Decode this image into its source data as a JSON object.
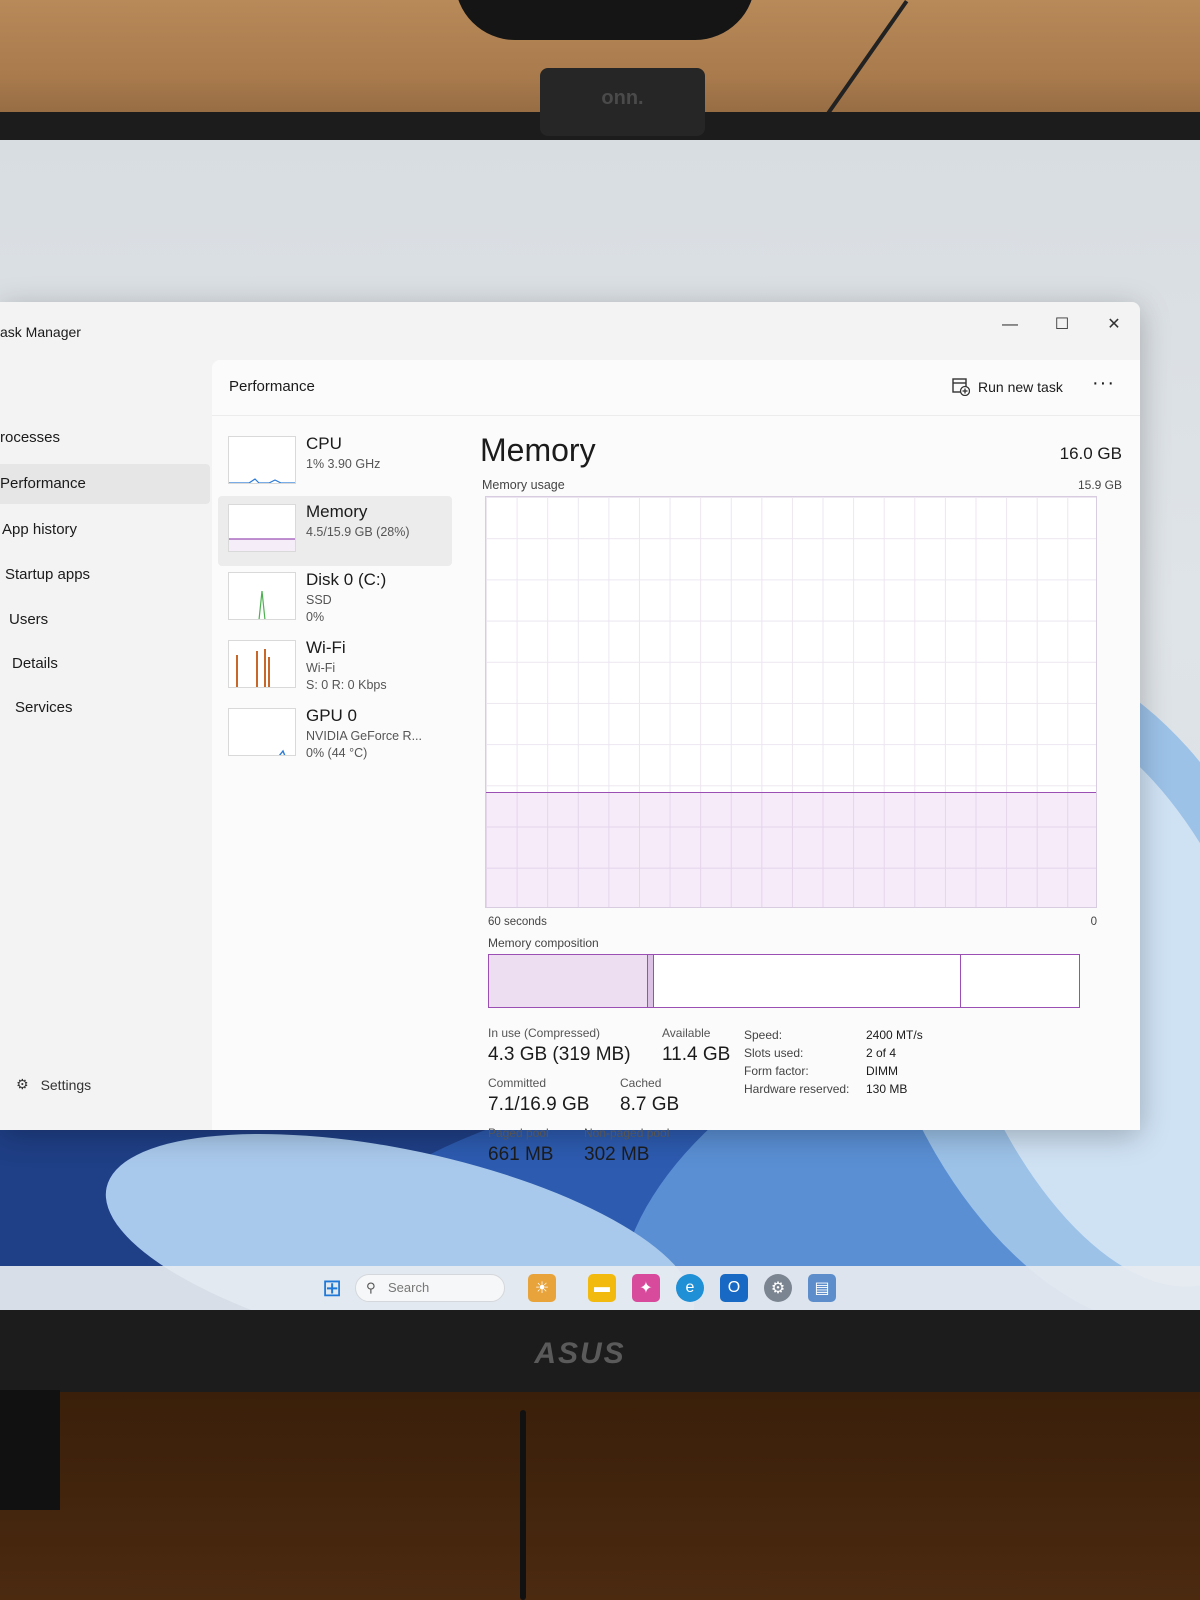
{
  "window": {
    "title": "ask Manager",
    "minimize_glyph": "—",
    "maximize_glyph": "☐",
    "close_glyph": "✕"
  },
  "nav": {
    "items": [
      {
        "label": "rocesses",
        "selected": false
      },
      {
        "label": "Performance",
        "selected": true
      },
      {
        "label": "App history",
        "selected": false
      },
      {
        "label": "Startup apps",
        "selected": false
      },
      {
        "label": "Users",
        "selected": false
      },
      {
        "label": "Details",
        "selected": false
      },
      {
        "label": "Services",
        "selected": false
      }
    ],
    "settings_label": "Settings"
  },
  "header": {
    "title": "Performance",
    "run_new_task": "Run new task",
    "more_glyph": "···"
  },
  "resources": [
    {
      "name": "CPU",
      "sub1": "1% 3.90 GHz",
      "sub2": "",
      "color": "#2b7bd8"
    },
    {
      "name": "Memory",
      "sub1": "4.5/15.9 GB (28%)",
      "sub2": "",
      "color": "#9b4fb4"
    },
    {
      "name": "Disk 0 (C:)",
      "sub1": "SSD",
      "sub2": "0%",
      "color": "#4cb050"
    },
    {
      "name": "Wi-Fi",
      "sub1": "Wi-Fi",
      "sub2": "S: 0 R: 0 Kbps",
      "color": "#c8672a"
    },
    {
      "name": "GPU 0",
      "sub1": "NVIDIA GeForce R...",
      "sub2": "0% (44 °C)",
      "color": "#2b7bd8"
    }
  ],
  "memory": {
    "title": "Memory",
    "total": "16.0 GB",
    "usage_label": "Memory usage",
    "usage_max": "15.9 GB",
    "usage_fraction": 0.28,
    "x_left": "60 seconds",
    "x_right": "0",
    "composition_label": "Memory composition",
    "composition": {
      "in_use_fraction": 0.27,
      "modified_fraction": 0.01,
      "standby_fraction": 0.52
    },
    "stats": {
      "in_use_label": "In use (Compressed)",
      "in_use_value": "4.3 GB (319 MB)",
      "available_label": "Available",
      "available_value": "11.4 GB",
      "committed_label": "Committed",
      "committed_value": "7.1/16.9 GB",
      "cached_label": "Cached",
      "cached_value": "8.7 GB",
      "paged_label": "Paged pool",
      "paged_value": "661 MB",
      "nonpaged_label": "Non-paged pool",
      "nonpaged_value": "302 MB"
    },
    "specs": {
      "speed_label": "Speed:",
      "speed_value": "2400 MT/s",
      "slots_label": "Slots used:",
      "slots_value": "2 of 4",
      "form_label": "Form factor:",
      "form_value": "DIMM",
      "reserved_label": "Hardware reserved:",
      "reserved_value": "130 MB"
    }
  },
  "taskbar": {
    "search_placeholder": "Search"
  },
  "environment": {
    "webcam_brand": "onn.",
    "monitor_brand": "ASUS"
  }
}
